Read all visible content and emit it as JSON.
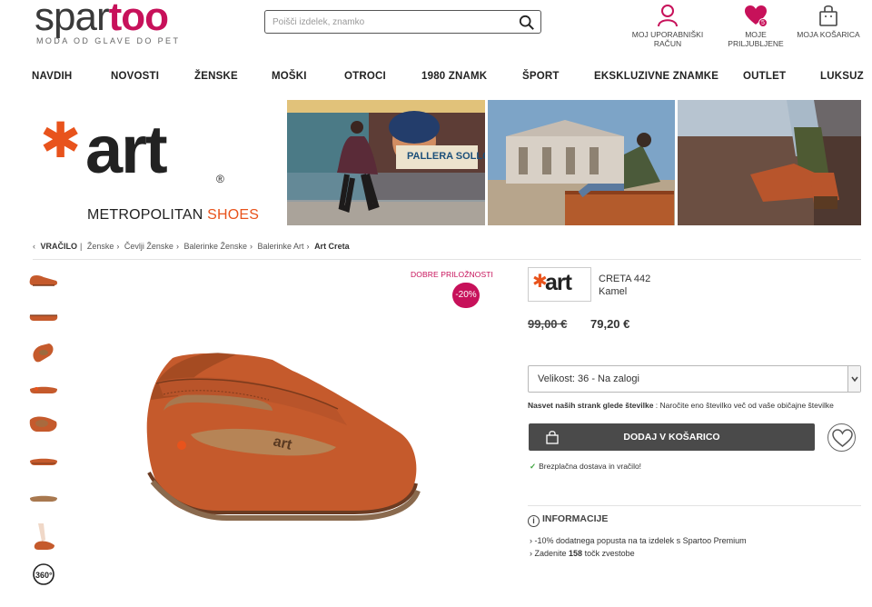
{
  "header": {
    "logo_left": "spar",
    "logo_right": "too",
    "tagline": "MODA OD GLAVE DO PET",
    "search_placeholder": "Poišči izdelek, znamko",
    "account_label": "MOJ UPORABNIŠKI RAČUN",
    "favorites_label": "MOJE PRILJUBLJENE",
    "favorites_count": "5",
    "cart_label": "MOJA KOŠARICA"
  },
  "nav": [
    "NAVDIH",
    "NOVOSTI",
    "ŽENSKE",
    "MOŠKI",
    "OTROCI",
    "1980 ZNAMK",
    "ŠPORT",
    "EKSKLUZIVNE ZNAMKE",
    "OUTLET",
    "LUKSUZ"
  ],
  "banner": {
    "brand": "art",
    "sub_left": "METROPOLITAN ",
    "sub_right": "SHOES",
    "photo1_sign": "PALLERA SOLLONERA"
  },
  "breadcrumb": {
    "back": "VRAČILO",
    "items": [
      "Ženske",
      "Čevlji Ženske",
      "Balerinke Ženske",
      "Balerinke Art"
    ],
    "current": "Art Creta"
  },
  "product": {
    "deal_label": "DOBRE PRILOŽNOSTI",
    "discount": "-20%",
    "brand_logo": "art",
    "model": "CRETA 442",
    "color": "Kamel",
    "old_price": "99,00 €",
    "new_price": "79,20 €",
    "size_select": "Velikost: 36 - Na zalogi",
    "advice_bold": "Nasvet naših strank glede številke",
    "advice_text": " : Naročite eno številko več od vaše običajne številke",
    "add_to_cart": "DODAJ V KOŠARICO",
    "free_delivery": "Brezplačna dostava in vračilo!",
    "info_title": "INFORMACIJE",
    "info_line1": "-10% dodatnega popusta na ta izdelek s Spartoo Premium",
    "info_line2_pre": "Zadenite ",
    "info_line2_bold": "158",
    "info_line2_post": " točk zvestobe",
    "thumb_360": "360°"
  },
  "colors": {
    "brand_pink": "#c7115a",
    "art_orange": "#e8531c",
    "shoe_leather": "#c55a2c"
  }
}
